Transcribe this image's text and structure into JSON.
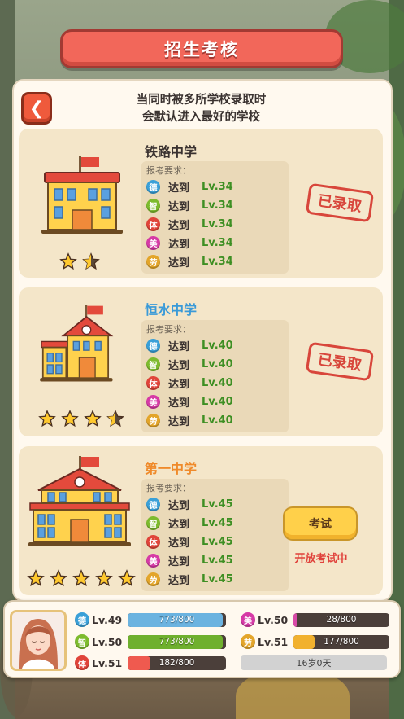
{
  "header": {
    "title": "招生考核"
  },
  "notice": {
    "line1": "当同时被多所学校录取时",
    "line2": "会默认进入最好的学校"
  },
  "requirement_title": "报考要求：",
  "reach_word": "达到",
  "attributes": [
    {
      "char": "德",
      "color": "#3aa0d8"
    },
    {
      "char": "智",
      "color": "#7dbb2e"
    },
    {
      "char": "体",
      "color": "#e0443a"
    },
    {
      "char": "美",
      "color": "#d63aa6"
    },
    {
      "char": "劳",
      "color": "#e3a52a"
    }
  ],
  "schools": [
    {
      "name": "铁路中学",
      "name_color": "#3a3230",
      "stars": 1.5,
      "levels": [
        "Lv.34",
        "Lv.34",
        "Lv.34",
        "Lv.34",
        "Lv.34"
      ],
      "status": "已录取"
    },
    {
      "name": "恒水中学",
      "name_color": "#3a9ad8",
      "stars": 3.5,
      "levels": [
        "Lv.40",
        "Lv.40",
        "Lv.40",
        "Lv.40",
        "Lv.40"
      ],
      "status": "已录取"
    },
    {
      "name": "第一中学",
      "name_color": "#ef8a2a",
      "stars": 5,
      "levels": [
        "Lv.45",
        "Lv.45",
        "Lv.45",
        "Lv.45",
        "Lv.45"
      ],
      "exam_button": "考试",
      "exam_status": "开放考试中"
    }
  ],
  "player": {
    "stats": [
      {
        "char": "德",
        "color": "#3aa0d8",
        "bar_color": "#6bb3e0",
        "level": "Lv.49",
        "value": "773/800",
        "fraction": 0.966
      },
      {
        "char": "智",
        "color": "#7dbb2e",
        "bar_color": "#6fb02e",
        "level": "Lv.50",
        "value": "773/800",
        "fraction": 0.966
      },
      {
        "char": "体",
        "color": "#e0443a",
        "bar_color": "#ef5a4f",
        "level": "Lv.51",
        "value": "182/800",
        "fraction": 0.2275
      },
      {
        "char": "美",
        "color": "#d63aa6",
        "bar_color": "#d94aa8",
        "level": "Lv.50",
        "value": "28/800",
        "fraction": 0.035
      },
      {
        "char": "劳",
        "color": "#e3a52a",
        "bar_color": "#f1b12e",
        "level": "Lv.51",
        "value": "177/800",
        "fraction": 0.221
      }
    ],
    "age": "16岁0天"
  }
}
